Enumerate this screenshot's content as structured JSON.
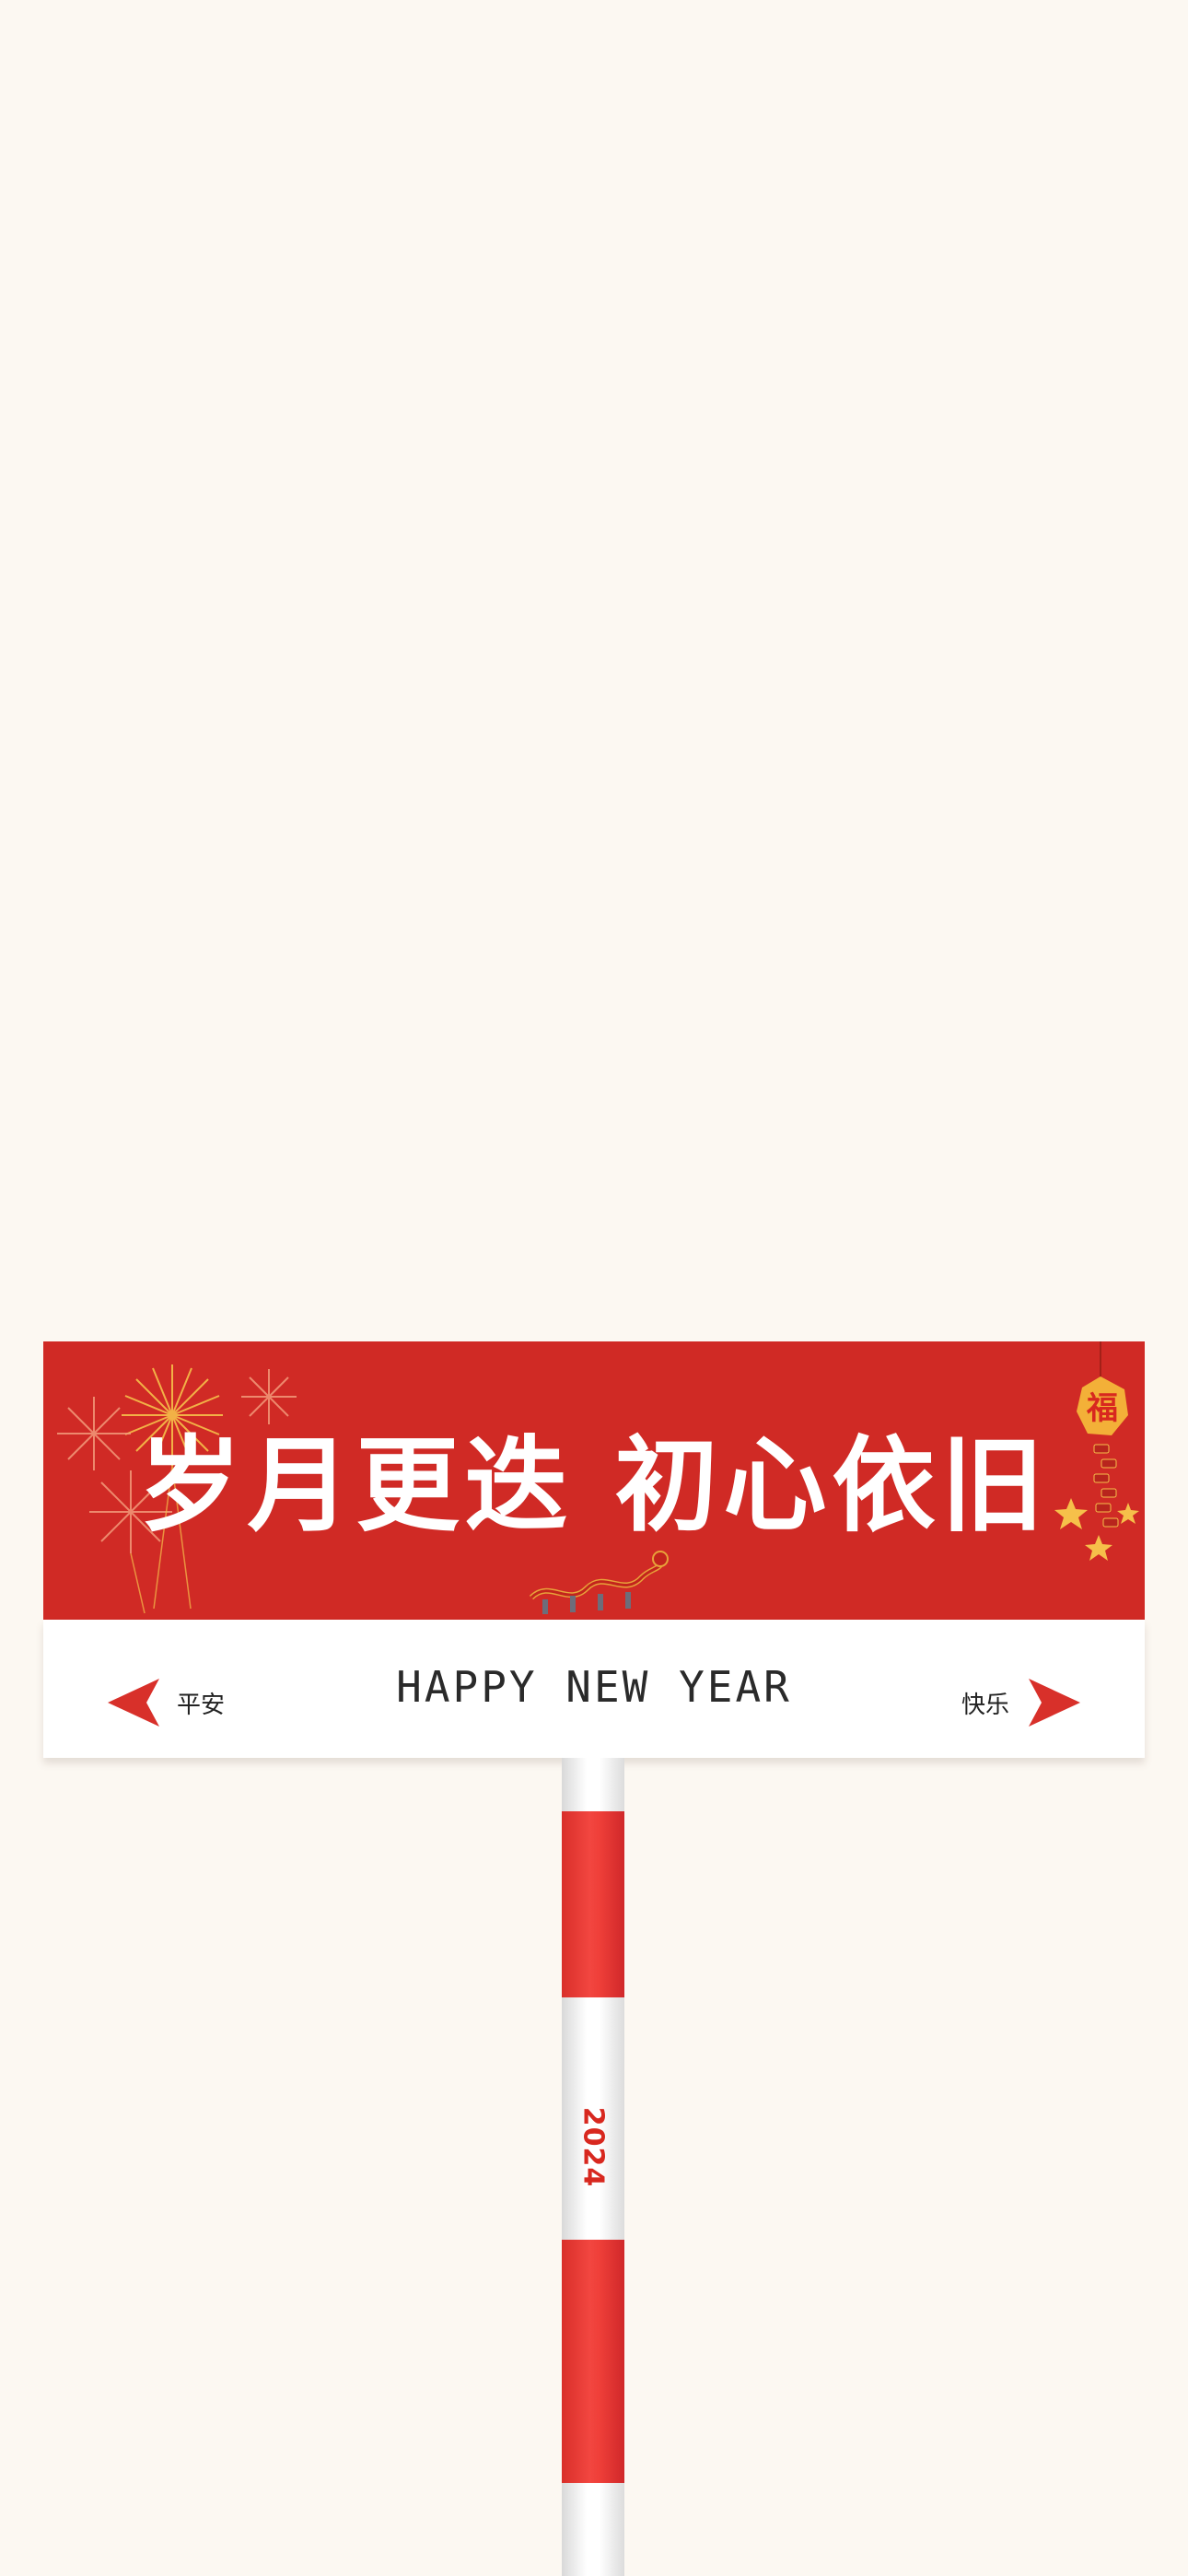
{
  "sign": {
    "headline": "岁月更迭 初心依旧",
    "tagline": "HAPPY NEW YEAR",
    "left_text": "平安",
    "right_text": "快乐",
    "fu_char": "福"
  },
  "pole": {
    "year": "2024"
  },
  "colors": {
    "background": "#fcf8f2",
    "sign_red": "#d02a25",
    "arrow_red": "#d8302a",
    "white": "#ffffff"
  },
  "icons": {
    "left_arrow": "triangle-left-icon",
    "right_arrow": "triangle-right-icon",
    "fireworks": "fireworks-icon",
    "fu_ornament": "fu-lantern-icon",
    "dragon": "dragon-dance-icon"
  }
}
